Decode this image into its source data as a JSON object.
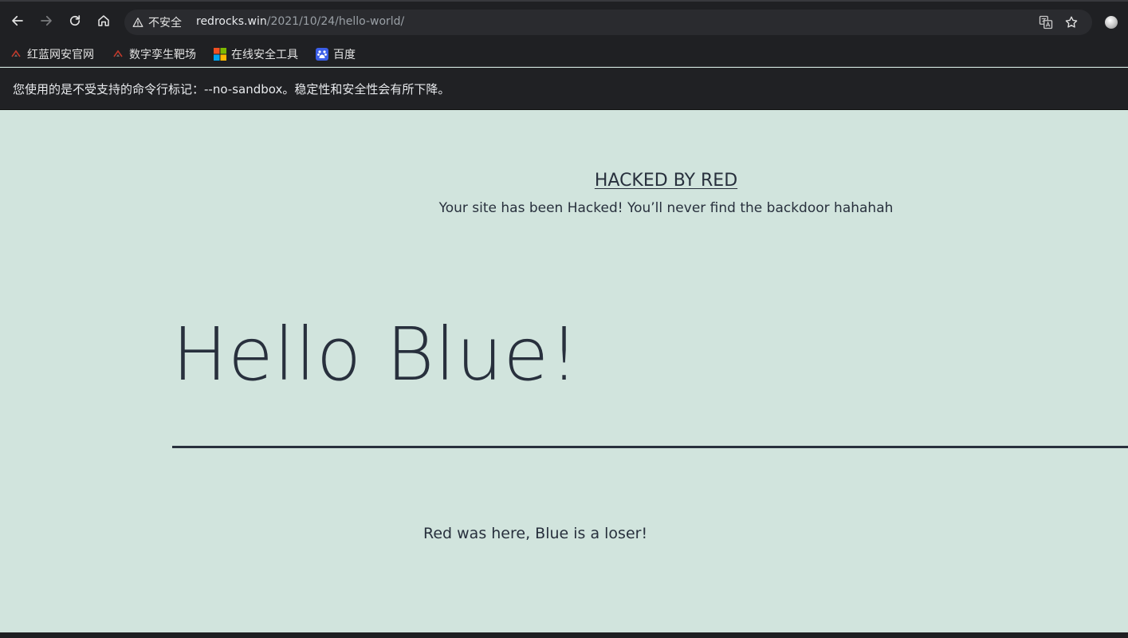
{
  "browser": {
    "security_label": "不安全",
    "url_host": "redrocks.win",
    "url_path": "/2021/10/24/hello-world/",
    "icons": [
      "back-icon",
      "forward-icon",
      "reload-icon",
      "home-icon",
      "translate-icon",
      "star-icon"
    ]
  },
  "bookmarks": [
    {
      "label": "红蓝网安官网",
      "icon": "redrocks-favicon"
    },
    {
      "label": "数字孪生靶场",
      "icon": "redrocks-favicon"
    },
    {
      "label": "在线安全工具",
      "icon": "microsoft-favicon"
    },
    {
      "label": "百度",
      "icon": "baidu-favicon"
    }
  ],
  "infobar": {
    "message": "您使用的是不受支持的命令行标记：--no-sandbox。稳定性和安全性会有所下降。"
  },
  "page": {
    "site_title": "HACKED BY RED",
    "tagline": "Your site has been Hacked! You’ll never find the backdoor hahahah",
    "post_title": "Hello Blue!",
    "post_body": "Red was here, Blue is a loser!",
    "colors": {
      "background": "#d1e4dd",
      "text": "#28303d"
    }
  }
}
